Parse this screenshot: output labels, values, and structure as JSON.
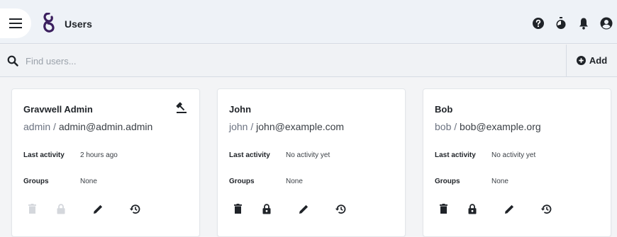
{
  "app": {
    "title": "Users"
  },
  "search": {
    "placeholder": "Find users..."
  },
  "toolbar": {
    "add_label": "Add"
  },
  "header_icons": [
    "help-icon",
    "timer-icon",
    "bell-icon",
    "account-icon"
  ],
  "labels": {
    "last_activity": "Last activity",
    "groups": "Groups"
  },
  "users": [
    {
      "name": "Gravwell Admin",
      "username": "admin",
      "email": "admin@admin.admin",
      "last_activity": "2 hours ago",
      "groups": "None",
      "is_admin": true,
      "actions_enabled": false
    },
    {
      "name": "John",
      "username": "john",
      "email": "john@example.com",
      "last_activity": "No activity yet",
      "groups": "None",
      "is_admin": false,
      "actions_enabled": true
    },
    {
      "name": "Bob",
      "username": "bob",
      "email": "bob@example.org",
      "last_activity": "No activity yet",
      "groups": "None",
      "is_admin": false,
      "actions_enabled": true
    }
  ],
  "colors": {
    "brand": "#3b1f5e",
    "icon": "#1f2328",
    "icon_disabled": "#d4d7dc",
    "separator": "#6b7280"
  }
}
